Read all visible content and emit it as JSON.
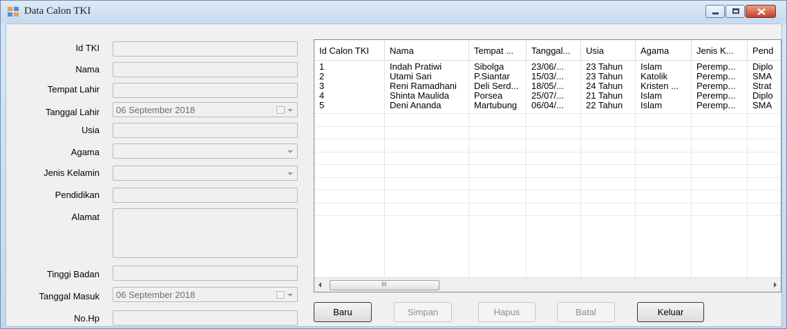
{
  "window": {
    "title": "Data Calon TKI"
  },
  "form": {
    "labels": {
      "id": "Id TKI",
      "nama": "Nama",
      "tempat_lahir": "Tempat Lahir",
      "tanggal_lahir": "Tanggal Lahir",
      "usia": "Usia",
      "agama": "Agama",
      "jenis_kelamin": "Jenis Kelamin",
      "pendidikan": "Pendidikan",
      "alamat": "Alamat",
      "tinggi_badan": "Tinggi Badan",
      "tanggal_masuk": "Tanggal Masuk",
      "no_hp": "No.Hp"
    },
    "values": {
      "tanggal_lahir": "06 September 2018",
      "tanggal_masuk": "06 September 2018"
    }
  },
  "grid": {
    "columns": [
      "Id Calon TKI",
      "Nama",
      "Tempat ...",
      "Tanggal...",
      "Usia",
      "Agama",
      "Jenis K...",
      "Pend"
    ],
    "rows": [
      [
        "1",
        "Indah Pratiwi",
        "Sibolga",
        "23/06/...",
        "23 Tahun",
        "Islam",
        "Peremp...",
        "Diplo"
      ],
      [
        "2",
        "Utami Sari",
        "P.Siantar",
        "15/03/...",
        "23 Tahun",
        "Katolik",
        "Peremp...",
        "SMA"
      ],
      [
        "3",
        "Reni Ramadhani",
        "Deli Serd...",
        "18/05/...",
        "24 Tahun",
        "Kristen ...",
        "Peremp...",
        "Strat"
      ],
      [
        "4",
        "Shinta Maulida",
        "Porsea",
        "25/07/...",
        "21 Tahun",
        "Islam",
        "Peremp...",
        "Diplo"
      ],
      [
        "5",
        "Deni Ananda",
        "Martubung",
        "06/04/...",
        "22 Tahun",
        "Islam",
        "Peremp...",
        "SMA"
      ]
    ],
    "scroll_thumb": "III"
  },
  "buttons": {
    "baru": "Baru",
    "simpan": "Simpan",
    "hapus": "Hapus",
    "batal": "Batal",
    "keluar": "Keluar"
  },
  "icons": [
    "app-icon",
    "minimize-icon",
    "maximize-icon",
    "close-icon",
    "calendar-icon",
    "chevron-down-icon",
    "scroll-left-icon",
    "scroll-right-icon"
  ]
}
